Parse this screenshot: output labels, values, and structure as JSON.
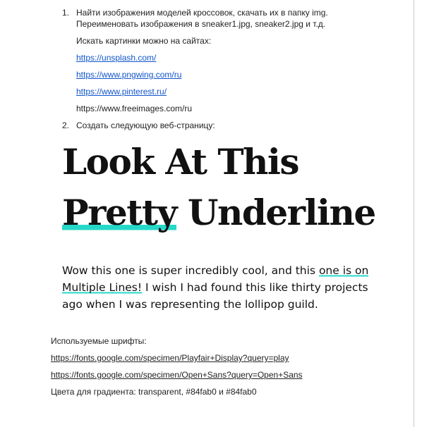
{
  "list": {
    "item1_number": "1.",
    "item1_line1": "Найти изображения моделей кроссовок, скачать их в папку img.",
    "item1_line2": "Переименовать изображения в sneaker1.jpg, sneaker2.jpg и т.д.",
    "sites_label": "Искать картинки можно на сайтах:",
    "links": [
      "https://unsplash.com/",
      "https://www.pngwing.com/ru",
      "https://www.pinterest.ru/"
    ],
    "plain_site": "https://www.freeimages.com/ru",
    "item2_number": "2.",
    "item2_text": "Создать следующую веб-страницу:"
  },
  "demo": {
    "heading_line1": "Look At This",
    "heading_highlight": "Pretty",
    "heading_rest": " Underline",
    "body_before": "Wow this one is super incredibly cool, and this ",
    "body_highlight": "one is on Multiple Lines!",
    "body_after": " I wish I had found this like thirty projects ago when I was representing the lollipop guild."
  },
  "footer": {
    "fonts_label": "Используемые шрифты:",
    "font_links": [
      "https://fonts.google.com/specimen/Playfair+Display?query=play",
      "https://fonts.google.com/specimen/Open+Sans?query=Open+Sans"
    ],
    "colors_text": "Цвета для градиента: transparent, #84fab0 и #84fab0"
  },
  "colors": {
    "link": "#1155cc",
    "underline_highlight": "#25d8c9",
    "gradient_color": "#84fab0"
  }
}
